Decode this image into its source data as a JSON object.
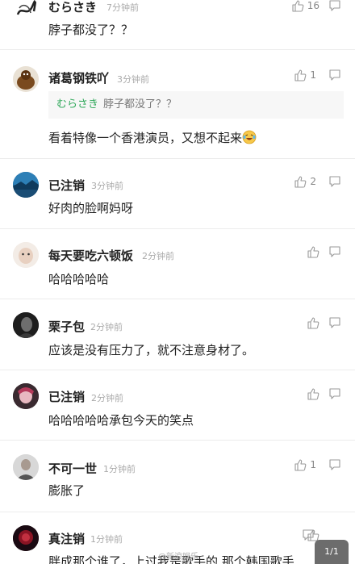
{
  "comments": [
    {
      "user": "むらさき",
      "time": "7分钟前",
      "likes": "16",
      "text": "脖子都没了？？",
      "avatar": "calligraphy"
    },
    {
      "user": "诸葛钢铁吖",
      "time": "3分钟前",
      "likes": "1",
      "quote_user": "むらさき",
      "quote_text": "脖子都没了？？",
      "text": "看着特像一个香港演员，又想不起来",
      "avatar": "brown-figure",
      "emoji": "laughing-tears-emoji"
    },
    {
      "user": "已注销",
      "time": "3分钟前",
      "likes": "2",
      "text": "好肉的脸啊妈呀",
      "avatar": "blue-landscape"
    },
    {
      "user": "每天要吃六顿饭",
      "time": "2分钟前",
      "likes": "",
      "text": "哈哈哈哈哈",
      "avatar": "light-face"
    },
    {
      "user": "栗子包",
      "time": "2分钟前",
      "likes": "",
      "text": "应该是没有压力了，就不注意身材了。",
      "avatar": "dark-portrait"
    },
    {
      "user": "已注销",
      "time": "2分钟前",
      "likes": "",
      "text": "哈哈哈哈哈承包今天的笑点",
      "avatar": "pink-portrait"
    },
    {
      "user": "不可一世",
      "time": "1分钟前",
      "likes": "1",
      "text": "膨胀了",
      "avatar": "grey-portrait"
    },
    {
      "user": "真注销",
      "time": "1分钟前",
      "likes": "",
      "text": "胖成那个谁了，上过我是歌手的 那个韩国歌手",
      "avatar": "red-dark-portrait"
    }
  ],
  "page_indicator": "1/1",
  "watermark": "@新浪娱乐",
  "colors": {
    "quote_user": "#2fa85a",
    "time": "#aaaaaa",
    "icon": "#999999"
  },
  "icons": [
    "thumbs-up-icon",
    "reply-icon"
  ]
}
